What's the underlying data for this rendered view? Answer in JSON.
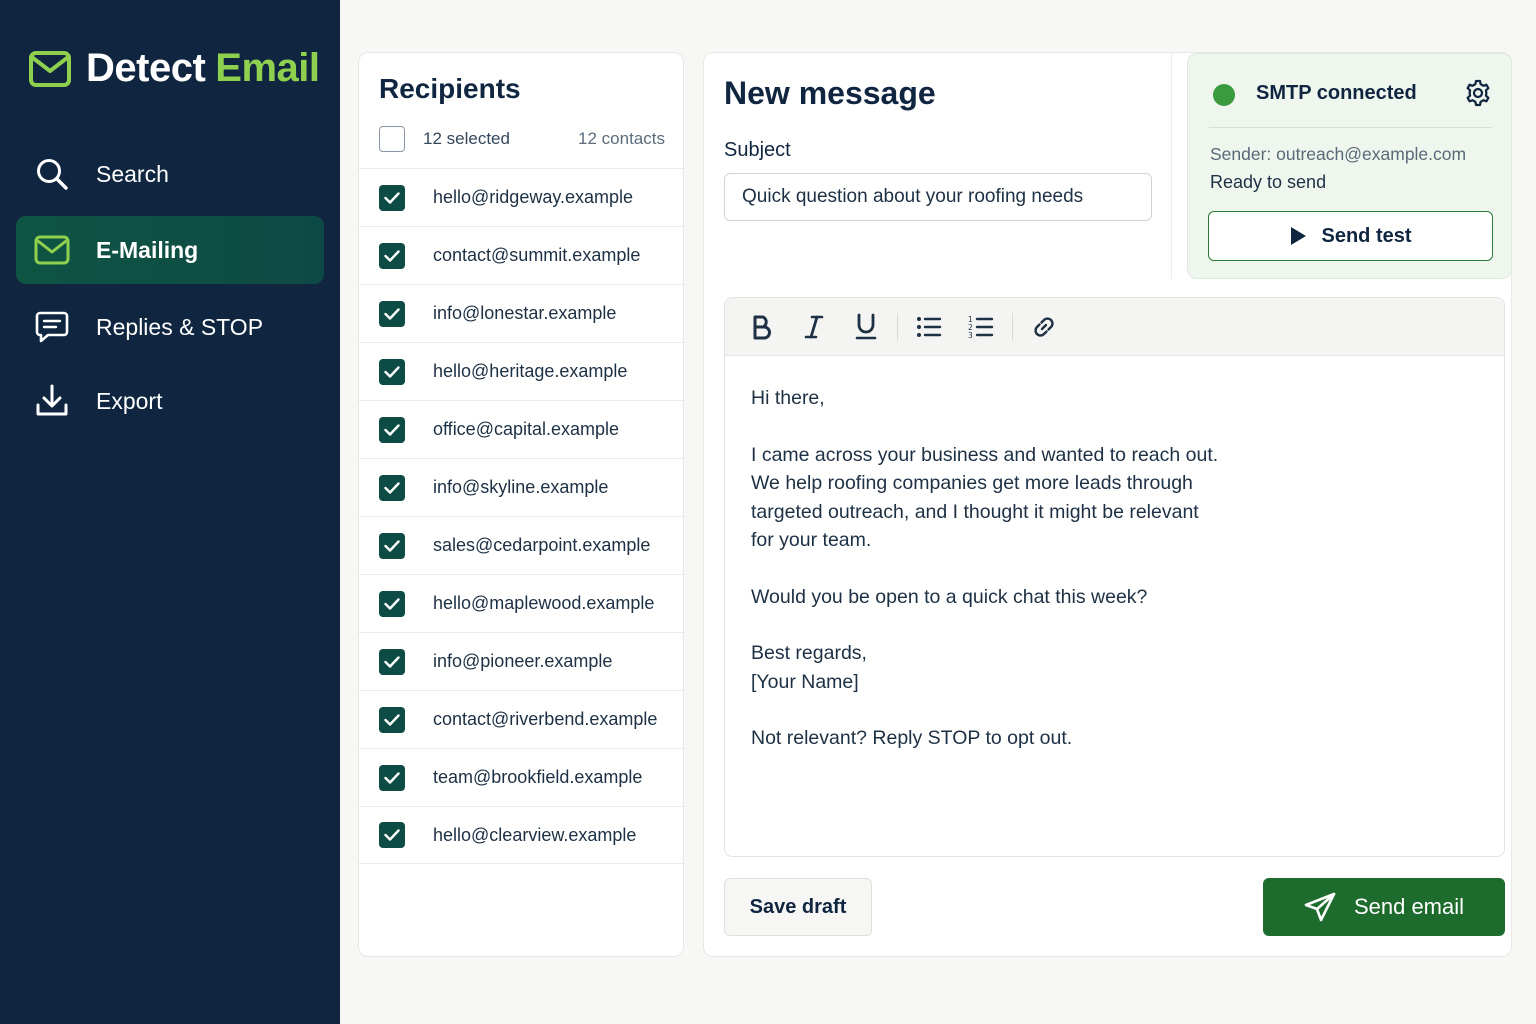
{
  "brand": {
    "name": "Detect",
    "accent": "Email",
    "accent_color": "#8fd14f",
    "icon": "mail-icon"
  },
  "sidebar": {
    "bg_color": "#0f2540",
    "items": [
      {
        "label": "Search",
        "icon": "search-icon",
        "active": false
      },
      {
        "label": "E-Mailing",
        "icon": "mail-icon",
        "active": true
      },
      {
        "label": "Replies & STOP",
        "icon": "message-icon",
        "active": false
      },
      {
        "label": "Export",
        "icon": "download-icon",
        "active": false
      }
    ]
  },
  "recipients": {
    "title": "Recipients",
    "selected_label": "12 selected",
    "count_label": "12 contacts",
    "list": [
      "hello@ridgeway.example",
      "contact@summit.example",
      "info@lonestar.example",
      "hello@heritage.example",
      "office@capital.example",
      "info@skyline.example",
      "sales@cedarpoint.example",
      "hello@maplewood.example",
      "info@pioneer.example",
      "contact@riverbend.example",
      "team@brookfield.example",
      "hello@clearview.example"
    ]
  },
  "compose": {
    "title": "New message",
    "subject_label": "Subject",
    "subject_value": "Quick question about your roofing needs",
    "toolbar": [
      "bold-icon",
      "italic-icon",
      "underline-icon",
      "bullet-list-icon",
      "numbered-list-icon",
      "link-icon"
    ],
    "body": {
      "greeting": "Hi there,",
      "line1": "I came across your business and wanted to reach out.",
      "line2": "We help roofing companies get more leads through",
      "line3": "targeted outreach, and I thought it might be relevant",
      "line4": "for your team.",
      "question": "Would you be open to a quick chat this week?",
      "closing": "Best regards,",
      "signature": "[Your Name]",
      "optout": "Not relevant? Reply STOP to opt out."
    },
    "save_label": "Save draft",
    "send_label": "Send email",
    "send_color": "#1e6b2e"
  },
  "smtp": {
    "status": "SMTP connected",
    "status_color": "#3a9a3e",
    "sender": "Sender: outreach@example.com",
    "ready": "Ready to send",
    "test_label": "Send test"
  }
}
